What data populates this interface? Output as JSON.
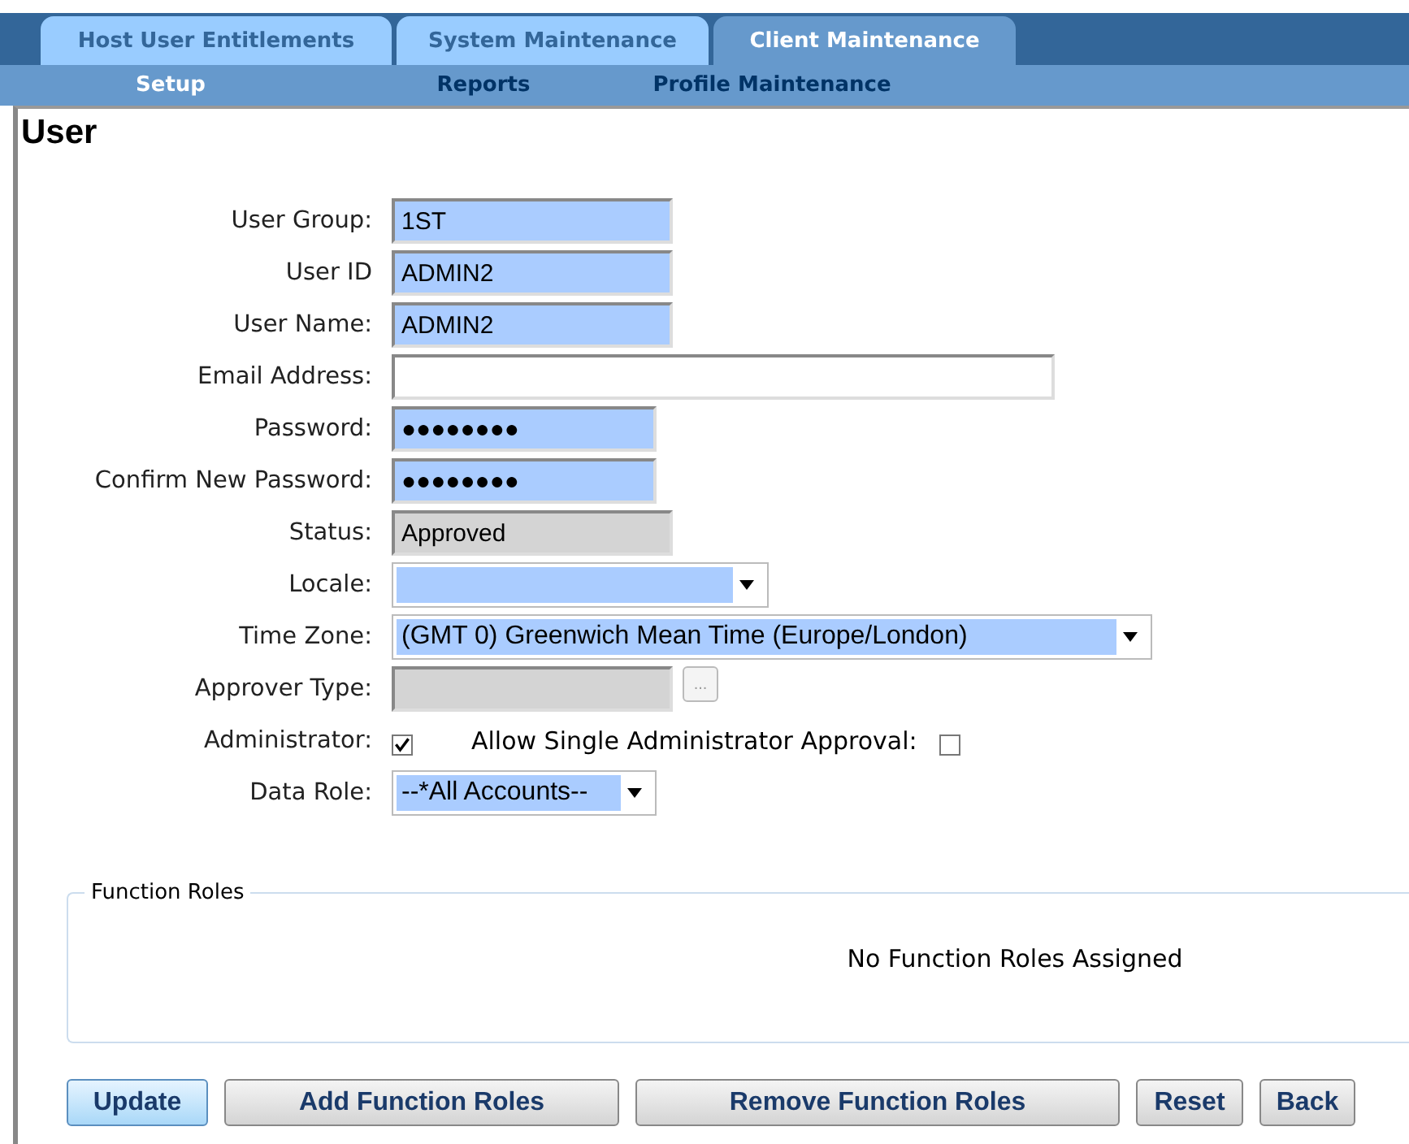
{
  "tabs": [
    {
      "label": "Host User Entitlements",
      "selected": false
    },
    {
      "label": "System Maintenance",
      "selected": false
    },
    {
      "label": "Client Maintenance",
      "selected": true
    }
  ],
  "subnav": [
    {
      "label": "Setup",
      "selected": true
    },
    {
      "label": "Reports",
      "selected": false
    },
    {
      "label": "Profile Maintenance",
      "selected": false
    }
  ],
  "page_title": "User",
  "form": [
    {
      "label": "User Group:",
      "kind": "text",
      "value": "1ST",
      "highlighted": true
    },
    {
      "label": "User ID",
      "kind": "text",
      "value": "ADMIN2",
      "highlighted": true
    },
    {
      "label": "User Name:",
      "kind": "text",
      "value": "ADMIN2",
      "highlighted": true
    },
    {
      "label": "Email Address:",
      "kind": "text",
      "highlighted": false
    },
    {
      "label": "Password:",
      "kind": "password",
      "value": "●●●●●●●●",
      "highlighted": true
    },
    {
      "label": "Confirm New Password:",
      "kind": "password",
      "value": "●●●●●●●●",
      "highlighted": true
    },
    {
      "label": "Status:",
      "kind": "readonly",
      "value": "Approved"
    },
    {
      "label": "Locale:",
      "kind": "select",
      "highlighted": true
    },
    {
      "label": "Time Zone:",
      "kind": "select",
      "value": "(GMT 0) Greenwich Mean Time (Europe/London)",
      "highlighted": true
    },
    {
      "label": "Approver Type:",
      "kind": "lookup",
      "button": "..."
    },
    {
      "label": "Administrator:",
      "kind": "checkbox",
      "checked": true,
      "extra_label": "Allow Single Administrator Approval:",
      "extra_checked": false
    },
    {
      "label": "Data Role:",
      "kind": "select",
      "value": "--*All Accounts--",
      "highlighted": true
    }
  ],
  "function_roles": {
    "legend": "Function Roles",
    "message": "No Function Roles Assigned"
  },
  "buttons": [
    {
      "label": "Update",
      "selected": true
    },
    {
      "label": "Add Function Roles",
      "selected": false
    },
    {
      "label": "Remove Function Roles",
      "selected": false
    },
    {
      "label": "Reset",
      "selected": false
    },
    {
      "label": "Back",
      "selected": false
    }
  ]
}
